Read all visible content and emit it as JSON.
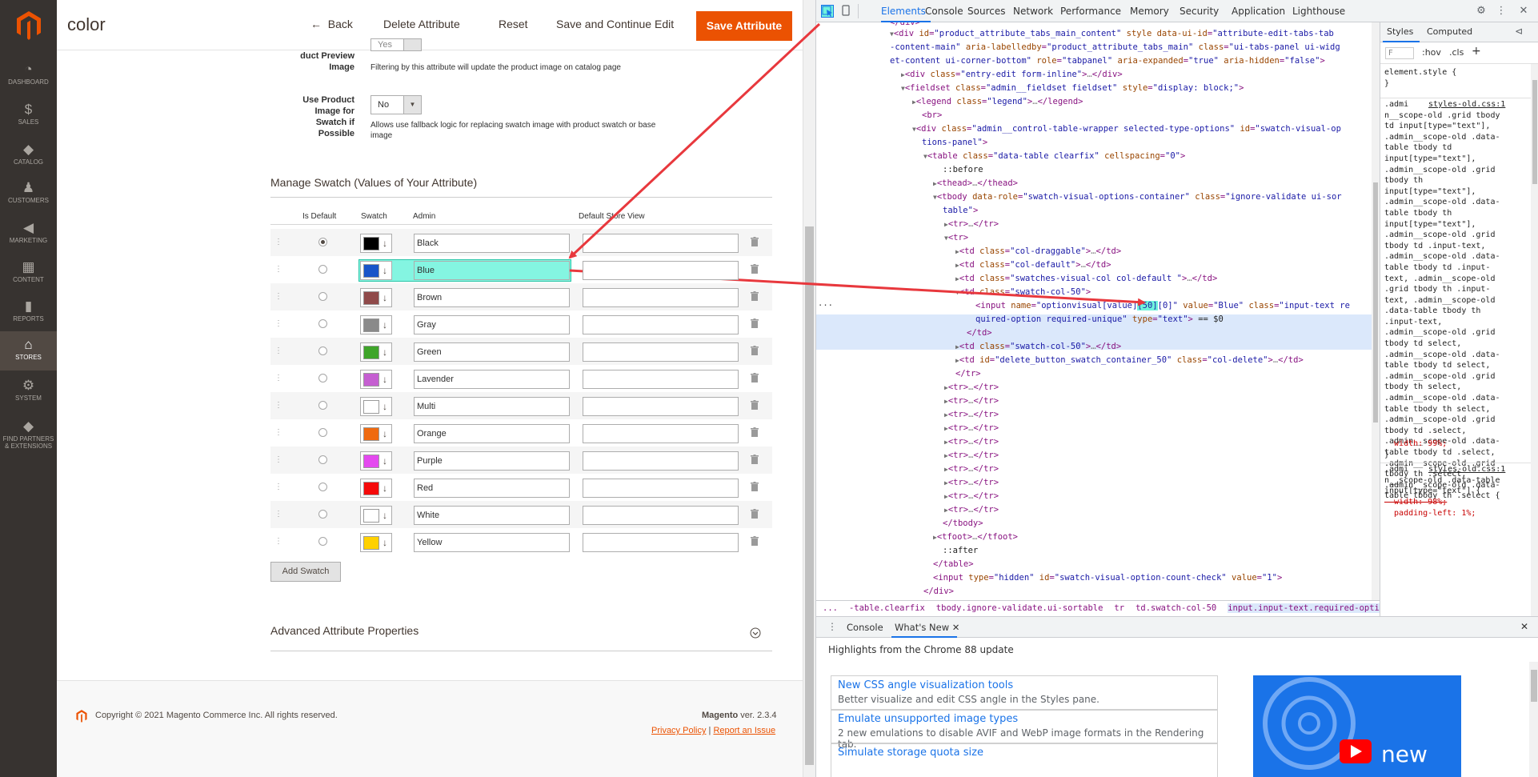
{
  "sidebar": {
    "items": [
      {
        "label": "DASHBOARD",
        "icon": "dashboard-icon",
        "glyph": "◔"
      },
      {
        "label": "SALES",
        "icon": "dollar-icon",
        "glyph": "$"
      },
      {
        "label": "CATALOG",
        "icon": "cube-icon",
        "glyph": "◆"
      },
      {
        "label": "CUSTOMERS",
        "icon": "person-icon",
        "glyph": "♟"
      },
      {
        "label": "MARKETING",
        "icon": "megaphone-icon",
        "glyph": "◀"
      },
      {
        "label": "CONTENT",
        "icon": "layout-icon",
        "glyph": "▦"
      },
      {
        "label": "REPORTS",
        "icon": "bar-chart-icon",
        "glyph": "▮"
      },
      {
        "label": "STORES",
        "icon": "store-icon",
        "glyph": "⌂"
      },
      {
        "label": "SYSTEM",
        "icon": "gear-icon",
        "glyph": "⚙"
      },
      {
        "label": "FIND PARTNERS",
        "label2": "& EXTENSIONS",
        "icon": "cube-icon",
        "glyph": "◆"
      }
    ]
  },
  "header": {
    "title": "color",
    "back": "Back",
    "back_arrow": "←",
    "delete": "Delete Attribute",
    "reset": "Reset",
    "save_continue": "Save and Continue Edit",
    "save": "Save Attribute"
  },
  "form": {
    "preview_label": "duct Preview",
    "preview_label2": "Image",
    "preview_value": "Yes",
    "preview_note": "Filtering by this attribute will update the product image on catalog page",
    "use_product_label": "Use Product",
    "use_product_label2": "Image for",
    "use_product_label3": "Swatch if",
    "use_product_label4": "Possible",
    "use_product_value": "No",
    "use_product_note": "Allows use fallback logic for replacing swatch image with product swatch or base",
    "use_product_note2": "image"
  },
  "swatch_section": {
    "title": "Manage Swatch (Values of Your Attribute)",
    "columns": {
      "is_default": "Is Default",
      "swatch": "Swatch",
      "admin": "Admin",
      "store_view": "Default Store View"
    },
    "rows": [
      {
        "admin": "Black",
        "color": "#000000",
        "default": true
      },
      {
        "admin": "Blue",
        "color": "#1955c9",
        "default": false
      },
      {
        "admin": "Brown",
        "color": "#8f4a4a",
        "default": false
      },
      {
        "admin": "Gray",
        "color": "#8a8a8a",
        "default": false
      },
      {
        "admin": "Green",
        "color": "#3fa52a",
        "default": false
      },
      {
        "admin": "Lavender",
        "color": "#c55fd1",
        "default": false
      },
      {
        "admin": "Multi",
        "color": "#ffffff",
        "default": false
      },
      {
        "admin": "Orange",
        "color": "#ef6a10",
        "default": false
      },
      {
        "admin": "Purple",
        "color": "#e449ef",
        "default": false
      },
      {
        "admin": "Red",
        "color": "#f50a0a",
        "default": false
      },
      {
        "admin": "White",
        "color": "#ffffff",
        "default": false
      },
      {
        "admin": "Yellow",
        "color": "#ffd100",
        "default": false
      }
    ],
    "add_button": "Add Swatch"
  },
  "advanced": {
    "title": "Advanced Attribute Properties"
  },
  "footer": {
    "copyright": "Copyright © 2021 Magento Commerce Inc. All rights reserved.",
    "brand": "Magento",
    "version": "ver. 2.3.4",
    "privacy": "Privacy Policy",
    "separator": "|",
    "report": "Report an Issue"
  },
  "devtools": {
    "tabs": [
      "Elements",
      "Console",
      "Sources",
      "Network",
      "Performance",
      "Memory",
      "Security",
      "Application",
      "Lighthouse"
    ],
    "active_tab": "Elements",
    "styles_tabs": [
      "Styles",
      "Computed"
    ],
    "filter_placeholder": "F",
    "hov": ":hov",
    "cls": ".cls",
    "breadcrumbs": [
      "...",
      "-table.clearfix",
      "tbody.ignore-validate.ui-sortable",
      "tr",
      "td.swatch-col-50",
      "input.input-text.required-option.required-unique"
    ],
    "styles_text": {
      "element_style": "element.style {\n}",
      "rule1_src": "styles-old.css:1",
      "rule1_sel": ".admi\nn__scope-old .grid tbody\ntd input[type=\"text\"],\n.admin__scope-old .data-\ntable tbody td\ninput[type=\"text\"],\n.admin__scope-old .grid\ntbody th\ninput[type=\"text\"],\n.admin__scope-old .data-\ntable tbody th\ninput[type=\"text\"],\n.admin__scope-old .grid\ntbody td .input-text,\n.admin__scope-old .data-\ntable tbody td .input-\ntext, .admin__scope-old\n.grid tbody th .input-\ntext, .admin__scope-old\n.data-table tbody th\n.input-text,\n.admin__scope-old .grid\ntbody td select,\n.admin__scope-old .data-\ntable tbody td select,\n.admin__scope-old .grid\ntbody th select,\n.admin__scope-old .data-\ntable tbody th select,\n.admin__scope-old .grid\ntbody td .select,\n.admin__scope-old .data-\ntable tbody td .select,\n.admin__scope-old .grid\ntbody th .select,\n.admin__scope-old .data-\ntable tbody th .select {",
      "rule1_prop": "  width: 99%;",
      "rule1_end": "}",
      "rule2_src": "styles-old.css:1",
      "rule2_sel": ".admi\nn__scope-old .data-table\ninput[type=\"text\"] {",
      "rule2_prop1": "  width: 98%;",
      "rule2_prop2": "  padding-left: 1%;"
    },
    "drawer": {
      "tabs": [
        "Console",
        "What's New"
      ],
      "heading": "Highlights from the Chrome 88 update",
      "cards": [
        {
          "title": "New CSS angle visualization tools",
          "desc": "Better visualize and edit CSS angle in the Styles pane."
        },
        {
          "title": "Emulate unsupported image types",
          "desc": "2 new emulations to disable AVIF and WebP image formats in the Rendering tab."
        },
        {
          "title": "Simulate storage quota size",
          "desc": ""
        }
      ],
      "promo_text": "new"
    }
  },
  "colors": {
    "accent": "#eb5202",
    "highlight": "#6ff3dc",
    "annotation": "#e8383d"
  }
}
